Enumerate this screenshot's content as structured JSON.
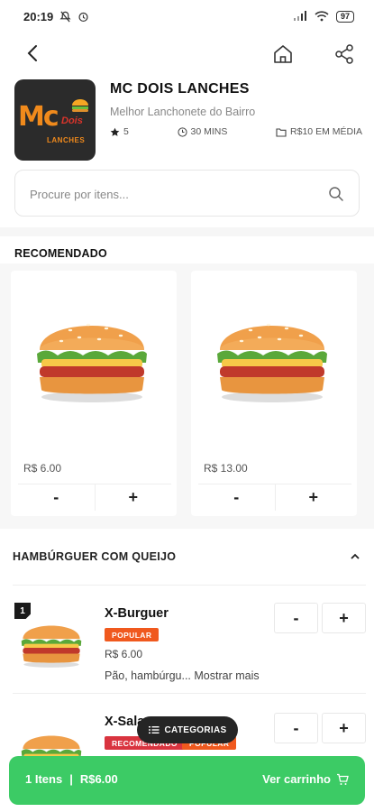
{
  "status": {
    "time": "20:19",
    "battery": "97"
  },
  "shop": {
    "name": "MC DOIS LANCHES",
    "subtitle": "Melhor Lanchonete do Bairro",
    "rating": "5",
    "time": "30 MINS",
    "avg_price": "R$10 EM MÉDIA",
    "logo": {
      "mc": "Mc",
      "dois": "Dois",
      "lanches": "LANCHES"
    }
  },
  "search": {
    "placeholder": "Procure por itens..."
  },
  "recommended": {
    "title": "RECOMENDADO",
    "items": [
      {
        "price": "R$ 6.00",
        "minus": "-",
        "plus": "+"
      },
      {
        "price": "R$ 13.00",
        "minus": "-",
        "plus": "+"
      }
    ]
  },
  "category": {
    "title": "HAMBÚRGUER COM QUEIJO",
    "items": [
      {
        "badge": "1",
        "name": "X-Burguer",
        "tag": "POPULAR",
        "price": "R$ 6.00",
        "desc": "Pão, hambúrgu...",
        "more": "Mostrar mais",
        "minus": "-",
        "plus": "+"
      },
      {
        "name": "X-Sala",
        "tag1": "RECOMENDADO",
        "tag2": "POPULAR",
        "minus": "-",
        "plus": "+"
      }
    ]
  },
  "fab": {
    "label": "CATEGORIAS"
  },
  "cart": {
    "count": "1 Itens",
    "sep": "|",
    "total": "R$6.00",
    "action": "Ver carrinho"
  },
  "colors": {
    "accent_green": "#3ccb65",
    "popular_tag": "#f0591e",
    "recommended_tag": "#d9343f"
  },
  "icons": [
    "back-arrow-icon",
    "home-icon",
    "share-icon",
    "star-icon",
    "clock-icon",
    "folder-icon",
    "search-icon",
    "chevron-up-icon",
    "list-icon",
    "cart-icon"
  ]
}
